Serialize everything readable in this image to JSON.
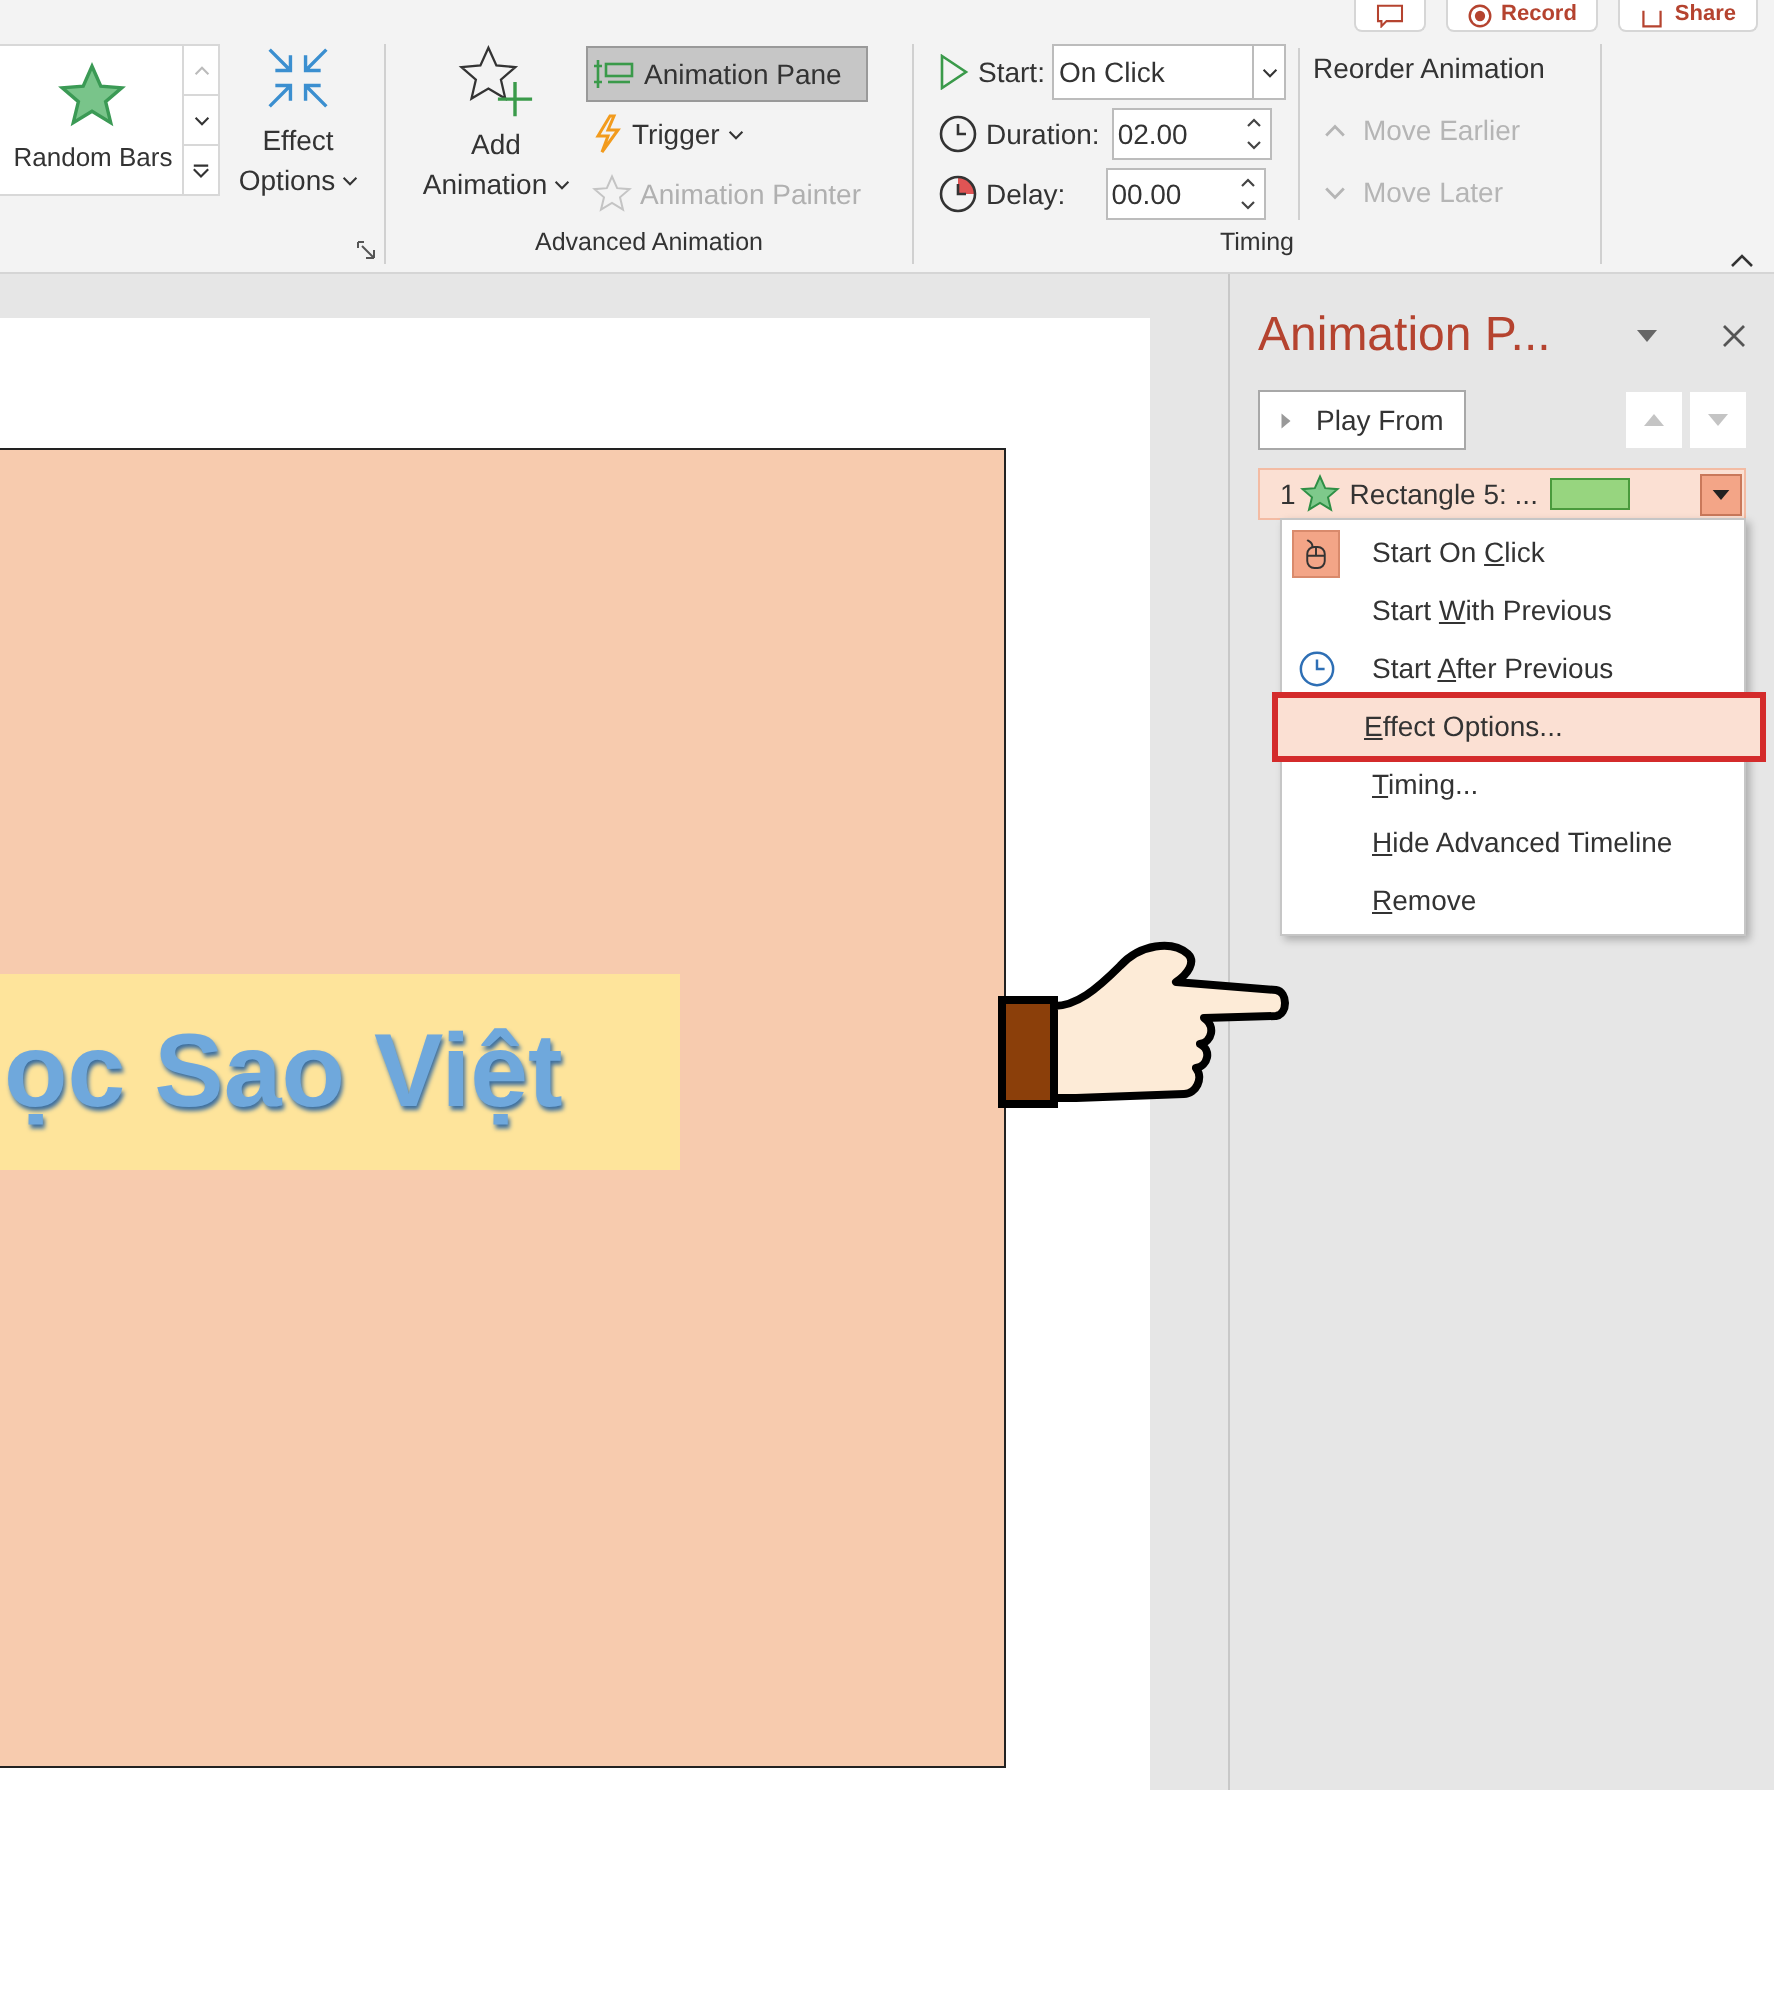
{
  "top_buttons": [
    {
      "kind": "comment"
    },
    {
      "kind": "record",
      "label": "Record"
    },
    {
      "kind": "share",
      "label": "Share"
    }
  ],
  "ribbon": {
    "effect_gallery": {
      "selected_effect": "Random Bars"
    },
    "effect_options": {
      "label_lines": [
        "Effect",
        "Options"
      ]
    },
    "groups": [
      {
        "label": "Advanced Animation"
      },
      {
        "label": "Timing"
      }
    ],
    "add_animation": {
      "label_lines": [
        "Add",
        "Animation"
      ]
    },
    "advanced_buttons": [
      {
        "kind": "pane",
        "label": "Animation Pane",
        "selected": true,
        "disabled": false
      },
      {
        "kind": "trigger",
        "label": "Trigger",
        "selected": false,
        "disabled": false
      },
      {
        "kind": "painter",
        "label": "Animation Painter",
        "selected": false,
        "disabled": true
      }
    ],
    "start": {
      "label": "Start:",
      "value": "On Click"
    },
    "duration": {
      "label": "Duration:",
      "value": "02.00"
    },
    "delay": {
      "label": "Delay:",
      "value": "00.00"
    },
    "reorder": {
      "title": "Reorder Animation",
      "buttons": [
        {
          "kind": "earlier",
          "label": "Move Earlier",
          "disabled": true
        },
        {
          "kind": "later",
          "label": "Move Later",
          "disabled": true
        }
      ]
    }
  },
  "slide": {
    "title_text": "ọc Sao Việt"
  },
  "pane": {
    "title": "Animation P...",
    "play_button": "Play From",
    "animation_item": {
      "number": "1",
      "name": "Rectangle 5: ..."
    },
    "menu": [
      {
        "before": "Start On ",
        "key": "C",
        "after": "lick",
        "kind": "mouse",
        "checked": true,
        "selected": false,
        "callout": false
      },
      {
        "before": "Start ",
        "key": "W",
        "after": "ith Previous",
        "kind": "plain",
        "checked": false,
        "selected": false,
        "callout": false
      },
      {
        "before": "Start ",
        "key": "A",
        "after": "fter Previous",
        "kind": "clock",
        "checked": false,
        "selected": false,
        "callout": false
      },
      {
        "key": "E",
        "after": "ffect Options...",
        "kind": "plain",
        "checked": false,
        "selected": true,
        "callout": true
      },
      {
        "key": "T",
        "after": "iming...",
        "kind": "plain",
        "checked": false,
        "selected": false,
        "callout": false
      },
      {
        "key": "H",
        "after": "ide Advanced Timeline",
        "kind": "plain",
        "checked": false,
        "selected": false,
        "callout": false
      },
      {
        "key": "R",
        "after": "emove",
        "kind": "plain",
        "checked": false,
        "selected": false,
        "callout": false
      }
    ]
  }
}
